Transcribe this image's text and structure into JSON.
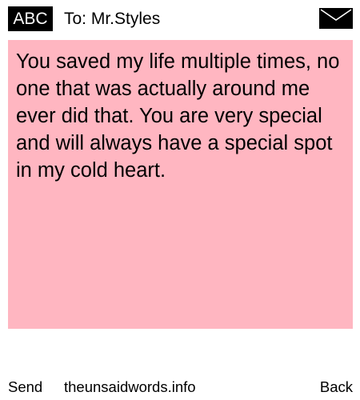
{
  "header": {
    "mode_badge": "ABC",
    "recipient": "To: Mr.Styles",
    "icon": "envelope-icon"
  },
  "message": {
    "text": "You saved my life multiple times, no one that was actually around me ever did that. You are very special and will always have a special spot in my cold heart.",
    "background_color": "#ffb6c1"
  },
  "footer": {
    "send_label": "Send",
    "site_label": "theunsaidwords.info",
    "back_label": "Back"
  }
}
